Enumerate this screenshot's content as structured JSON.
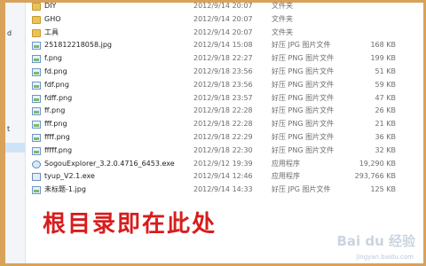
{
  "sidebar": {
    "frag1": "d",
    "frag2": "t"
  },
  "files": [
    {
      "name": "DIY",
      "date": "2012/9/14 20:07",
      "type": "文件夹",
      "size": "",
      "icon": "folder"
    },
    {
      "name": "GHO",
      "date": "2012/9/14 20:07",
      "type": "文件夹",
      "size": "",
      "icon": "folder"
    },
    {
      "name": "工具",
      "date": "2012/9/14 20:07",
      "type": "文件夹",
      "size": "",
      "icon": "folder"
    },
    {
      "name": "251812218058.jpg",
      "date": "2012/9/14 15:08",
      "type": "好压 JPG 图片文件",
      "size": "168 KB",
      "icon": "image"
    },
    {
      "name": "f.png",
      "date": "2012/9/18 22:27",
      "type": "好压 PNG 图片文件",
      "size": "199 KB",
      "icon": "image"
    },
    {
      "name": "fd.png",
      "date": "2012/9/18 23:56",
      "type": "好压 PNG 图片文件",
      "size": "51 KB",
      "icon": "image"
    },
    {
      "name": "fdf.png",
      "date": "2012/9/18 23:56",
      "type": "好压 PNG 图片文件",
      "size": "59 KB",
      "icon": "image"
    },
    {
      "name": "fdff.png",
      "date": "2012/9/18 23:57",
      "type": "好压 PNG 图片文件",
      "size": "47 KB",
      "icon": "image"
    },
    {
      "name": "ff.png",
      "date": "2012/9/18 22:28",
      "type": "好压 PNG 图片文件",
      "size": "26 KB",
      "icon": "image"
    },
    {
      "name": "fff.png",
      "date": "2012/9/18 22:28",
      "type": "好压 PNG 图片文件",
      "size": "21 KB",
      "icon": "image"
    },
    {
      "name": "ffff.png",
      "date": "2012/9/18 22:29",
      "type": "好压 PNG 图片文件",
      "size": "36 KB",
      "icon": "image"
    },
    {
      "name": "fffff.png",
      "date": "2012/9/18 22:30",
      "type": "好压 PNG 图片文件",
      "size": "32 KB",
      "icon": "image"
    },
    {
      "name": "SogouExplorer_3.2.0.4716_6453.exe",
      "date": "2012/9/12 19:39",
      "type": "应用程序",
      "size": "19,290 KB",
      "icon": "exe"
    },
    {
      "name": "tyup_V2.1.exe",
      "date": "2012/9/14 12:46",
      "type": "应用程序",
      "size": "293,766 KB",
      "icon": "exe2"
    },
    {
      "name": "未标题-1.jpg",
      "date": "2012/9/14 14:33",
      "type": "好压 JPG 图片文件",
      "size": "125 KB",
      "icon": "image"
    }
  ],
  "annotation": "根目录即在此处",
  "watermark": {
    "main": "Bai du 经验",
    "sub": "jingyan.baidu.com"
  }
}
